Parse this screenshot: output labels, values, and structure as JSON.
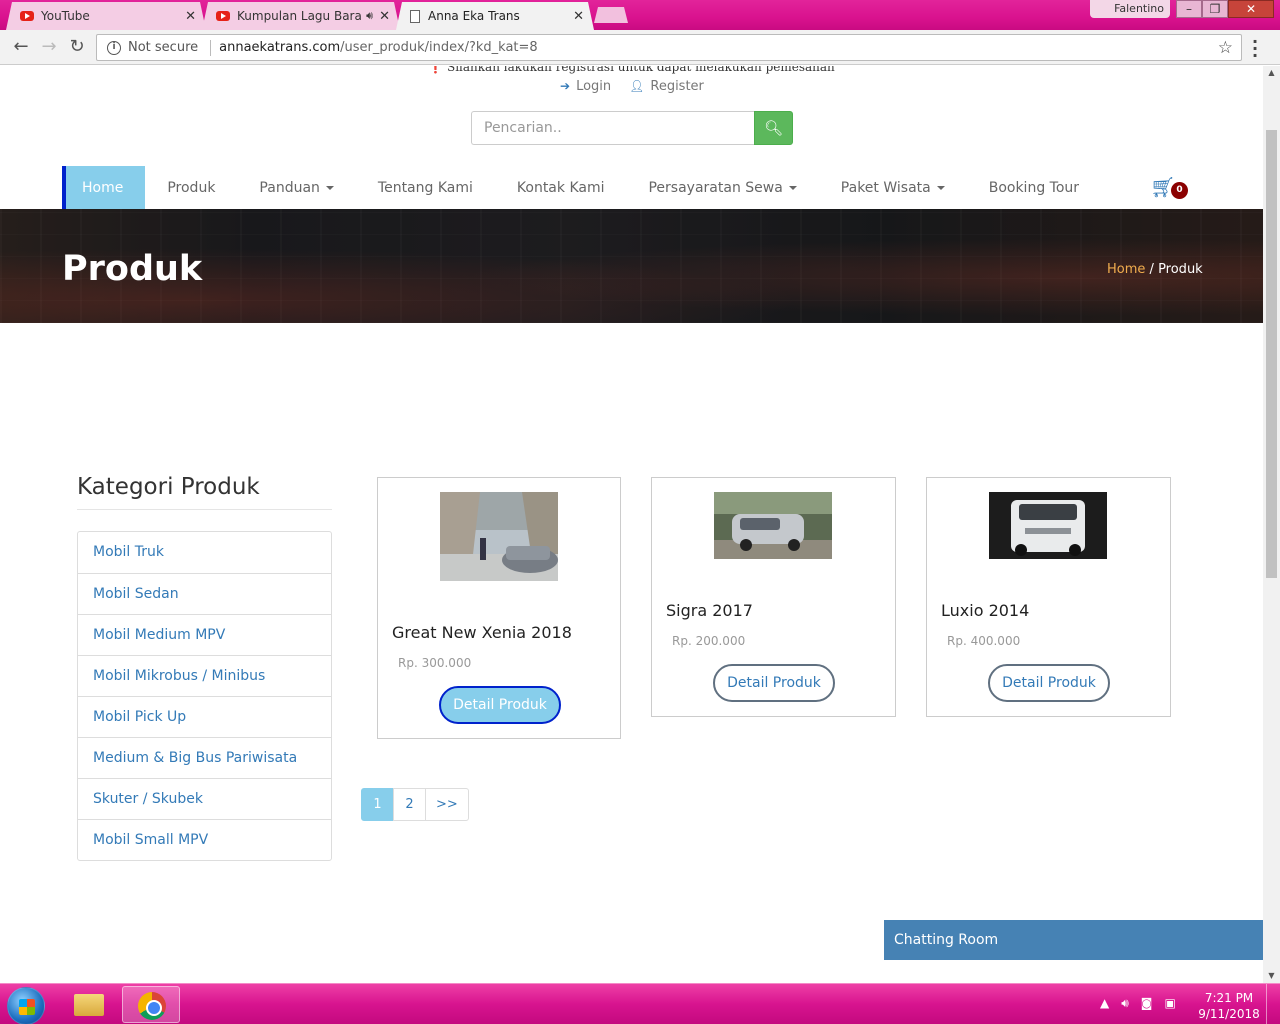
{
  "browser": {
    "tabs": [
      {
        "label": "YouTube",
        "icon": "youtube-icon"
      },
      {
        "label": "Kumpulan Lagu Barat",
        "icon": "youtube-icon"
      },
      {
        "label": "Anna Eka Trans",
        "icon": "page-icon"
      }
    ],
    "profile": "Falentino",
    "security": "Not secure",
    "url_host": "annaekatrans.com",
    "url_path": "/user_produk/index/?kd_kat=8"
  },
  "header": {
    "notice": "Silahkan lakukan registrasi untuk dapat melakukan pemesanan",
    "login": "Login",
    "register": "Register",
    "search_placeholder": "Pencarian.."
  },
  "nav": {
    "items": [
      "Home",
      "Produk",
      "Panduan",
      "Tentang Kami",
      "Kontak Kami",
      "Persayaratan Sewa",
      "Paket Wisata",
      "Booking Tour"
    ],
    "cart_count": "0"
  },
  "hero": {
    "title": "Produk",
    "breadcrumb_home": "Home",
    "breadcrumb_sep": "/",
    "breadcrumb_current": "Produk"
  },
  "sidebar": {
    "title": "Kategori Produk",
    "categories": [
      "Mobil Truk",
      "Mobil Sedan",
      "Mobil Medium MPV",
      "Mobil Mikrobus / Minibus",
      "Mobil Pick Up",
      "Medium & Big Bus Pariwisata",
      "Skuter / Skubek",
      "Mobil Small MPV"
    ]
  },
  "products": [
    {
      "name": "Great New Xenia 2018",
      "price": "Rp. 300.000",
      "button": "Detail Produk"
    },
    {
      "name": "Sigra 2017",
      "price": "Rp. 200.000",
      "button": "Detail Produk"
    },
    {
      "name": "Luxio 2014",
      "price": "Rp. 400.000",
      "button": "Detail Produk"
    }
  ],
  "pagination": [
    "1",
    "2",
    ">>"
  ],
  "chat": {
    "label": "Chatting Room"
  },
  "taskbar": {
    "time": "7:21 PM",
    "date": "9/11/2018"
  },
  "colors": {
    "nav_active": "#87ceeb",
    "link": "#337ab7",
    "search_button": "#5cb85c",
    "chat": "#4682b4",
    "cart_badge": "#8b0000"
  }
}
